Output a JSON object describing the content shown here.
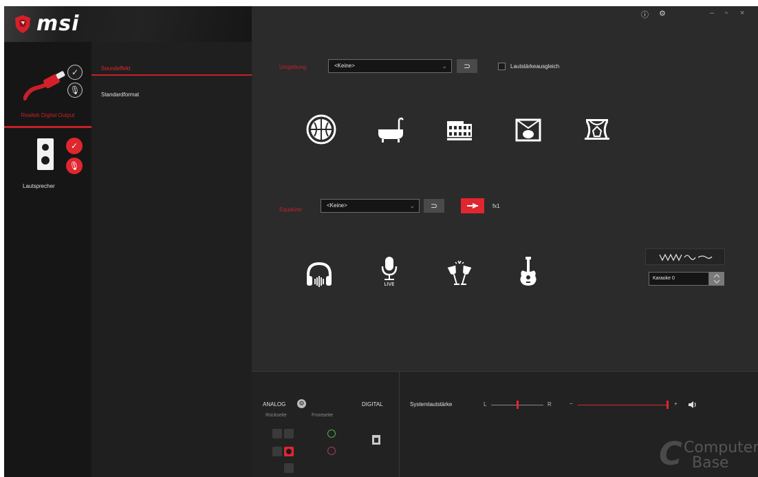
{
  "app": {
    "brand": "msi"
  },
  "devices": {
    "digital": {
      "label": "Realtek Digital Output"
    },
    "speaker": {
      "label": "Lautsprecher"
    }
  },
  "tabs": [
    {
      "label": "Soundeffekt",
      "active": true
    },
    {
      "label": "Standardformat",
      "active": false
    }
  ],
  "environment": {
    "label": "Umgebung",
    "dropdown_value": "<Keine>",
    "reset_glyph": "⊃",
    "loudness_label": "Lautstärkeausgleich",
    "loudness_checked": false,
    "icons": [
      "stone-arena-icon",
      "bathtub-icon",
      "colosseum-icon",
      "stage-icon",
      "theater-icon"
    ]
  },
  "equalizer": {
    "label": "Equalizer",
    "dropdown_value": "<Keine>",
    "reset_glyph": "⊃",
    "toggle_text": "fx1",
    "icons": [
      "headphones-icon",
      "live-microphone-icon",
      "party-glasses-icon",
      "guitar-icon"
    ],
    "karaoke_value": "Karaoke 0"
  },
  "bottom": {
    "analog_label": "ANALOG",
    "digital_label": "DIGITAL",
    "rear_label": "Rückseite",
    "front_label": "Frontseite",
    "volume_label": "Systemlautstärke",
    "balance_left": "L",
    "balance_right": "R",
    "volume_minus": "−",
    "volume_plus": "+"
  },
  "watermark": {
    "line1": "Computer",
    "line2": "Base"
  },
  "colors": {
    "accent": "#e0262e",
    "panel": "#2b2b2b",
    "sidebar": "#161616"
  }
}
